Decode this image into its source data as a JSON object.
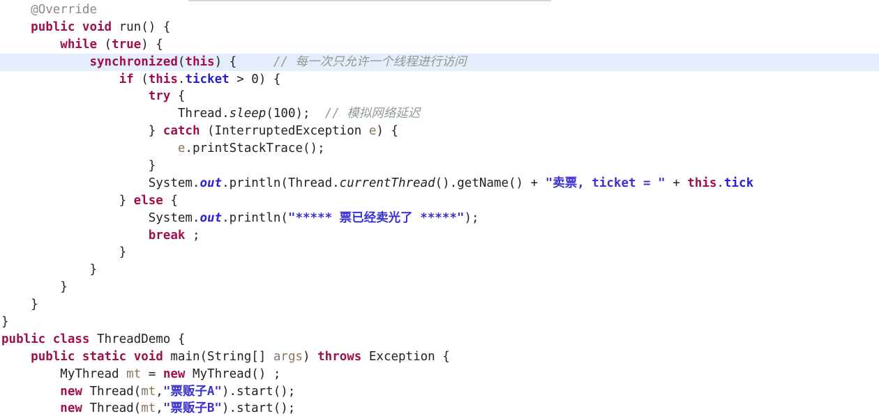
{
  "editor": {
    "kind": "java-source-code-view",
    "language": "Java",
    "background_color": "#ffffff",
    "current_line_highlight_color": "#e4edfb",
    "current_line_index": 3,
    "truncated_right_edge": true,
    "colors": {
      "keyword": "#a0104e",
      "plain_text": "#222222",
      "field": "#2a20d8",
      "static_member": "#2a20d8",
      "string_literal": "#3a32d0",
      "comment": "#8d9c92",
      "annotation": "#8a8a8a",
      "variable": "#8a7560"
    }
  },
  "lines": [
    {
      "n": 1,
      "indent": 4,
      "tokens": [
        {
          "t": "@Override",
          "c": "anno"
        }
      ]
    },
    {
      "n": 2,
      "indent": 4,
      "tokens": [
        {
          "t": "public",
          "c": "kw"
        },
        {
          "t": " ",
          "c": "plain"
        },
        {
          "t": "void",
          "c": "kw"
        },
        {
          "t": " run() {",
          "c": "plain"
        }
      ]
    },
    {
      "n": 3,
      "indent": 8,
      "tokens": [
        {
          "t": "while",
          "c": "kw"
        },
        {
          "t": " (",
          "c": "plain"
        },
        {
          "t": "true",
          "c": "kw"
        },
        {
          "t": ") {",
          "c": "plain"
        }
      ]
    },
    {
      "n": 4,
      "indent": 12,
      "current": true,
      "tokens": [
        {
          "t": "synchronized",
          "c": "kw"
        },
        {
          "t": "(",
          "c": "plain"
        },
        {
          "t": "this",
          "c": "kw"
        },
        {
          "t": ") {",
          "c": "plain"
        },
        {
          "t": "     ",
          "c": "plain"
        },
        {
          "t": "// 每一次只允许一个线程进行访问",
          "c": "cmt"
        }
      ]
    },
    {
      "n": 5,
      "indent": 16,
      "tokens": [
        {
          "t": "if",
          "c": "kw"
        },
        {
          "t": " (",
          "c": "plain"
        },
        {
          "t": "this",
          "c": "kw"
        },
        {
          "t": ".",
          "c": "plain"
        },
        {
          "t": "ticket",
          "c": "field"
        },
        {
          "t": " > ",
          "c": "plain"
        },
        {
          "t": "0",
          "c": "num"
        },
        {
          "t": ") {",
          "c": "plain"
        }
      ]
    },
    {
      "n": 6,
      "indent": 20,
      "tokens": [
        {
          "t": "try",
          "c": "kw"
        },
        {
          "t": " {",
          "c": "plain"
        }
      ]
    },
    {
      "n": 7,
      "indent": 24,
      "tokens": [
        {
          "t": "Thread.",
          "c": "plain"
        },
        {
          "t": "sleep",
          "c": "staticm"
        },
        {
          "t": "(",
          "c": "plain"
        },
        {
          "t": "100",
          "c": "num"
        },
        {
          "t": ");",
          "c": "plain"
        },
        {
          "t": "  ",
          "c": "plain"
        },
        {
          "t": "// 模拟网络延迟",
          "c": "cmt"
        }
      ]
    },
    {
      "n": 8,
      "indent": 20,
      "tokens": [
        {
          "t": "} ",
          "c": "plain"
        },
        {
          "t": "catch",
          "c": "kw"
        },
        {
          "t": " (InterruptedException ",
          "c": "plain"
        },
        {
          "t": "e",
          "c": "var"
        },
        {
          "t": ") {",
          "c": "plain"
        }
      ]
    },
    {
      "n": 9,
      "indent": 24,
      "tokens": [
        {
          "t": "e",
          "c": "var"
        },
        {
          "t": ".printStackTrace();",
          "c": "plain"
        }
      ]
    },
    {
      "n": 10,
      "indent": 20,
      "tokens": [
        {
          "t": "}",
          "c": "plain"
        }
      ]
    },
    {
      "n": 11,
      "indent": 20,
      "tokens": [
        {
          "t": "System.",
          "c": "plain"
        },
        {
          "t": "out",
          "c": "staticf"
        },
        {
          "t": ".println(Thread.",
          "c": "plain"
        },
        {
          "t": "currentThread",
          "c": "staticm"
        },
        {
          "t": "().getName() + ",
          "c": "plain"
        },
        {
          "t": "\"卖票, ticket = \"",
          "c": "str"
        },
        {
          "t": " + ",
          "c": "plain"
        },
        {
          "t": "this",
          "c": "kw"
        },
        {
          "t": ".",
          "c": "plain"
        },
        {
          "t": "tick",
          "c": "clip"
        }
      ]
    },
    {
      "n": 12,
      "indent": 16,
      "tokens": [
        {
          "t": "} ",
          "c": "plain"
        },
        {
          "t": "else",
          "c": "kw"
        },
        {
          "t": " {",
          "c": "plain"
        }
      ]
    },
    {
      "n": 13,
      "indent": 20,
      "tokens": [
        {
          "t": "System.",
          "c": "plain"
        },
        {
          "t": "out",
          "c": "staticf"
        },
        {
          "t": ".println(",
          "c": "plain"
        },
        {
          "t": "\"***** 票已经卖光了 *****\"",
          "c": "str"
        },
        {
          "t": ");",
          "c": "plain"
        }
      ]
    },
    {
      "n": 14,
      "indent": 20,
      "tokens": [
        {
          "t": "break",
          "c": "kw"
        },
        {
          "t": " ;",
          "c": "plain"
        }
      ]
    },
    {
      "n": 15,
      "indent": 16,
      "tokens": [
        {
          "t": "}",
          "c": "plain"
        }
      ]
    },
    {
      "n": 16,
      "indent": 12,
      "tokens": [
        {
          "t": "}",
          "c": "plain"
        }
      ]
    },
    {
      "n": 17,
      "indent": 8,
      "tokens": [
        {
          "t": "}",
          "c": "plain"
        }
      ]
    },
    {
      "n": 18,
      "indent": 4,
      "tokens": [
        {
          "t": "}",
          "c": "plain"
        }
      ]
    },
    {
      "n": 19,
      "indent": 0,
      "tokens": [
        {
          "t": "}",
          "c": "plain"
        }
      ]
    },
    {
      "n": 20,
      "indent": 0,
      "tokens": [
        {
          "t": "public",
          "c": "kw"
        },
        {
          "t": " ",
          "c": "plain"
        },
        {
          "t": "class",
          "c": "kw"
        },
        {
          "t": " ThreadDemo {",
          "c": "plain"
        }
      ]
    },
    {
      "n": 21,
      "indent": 4,
      "tokens": [
        {
          "t": "public",
          "c": "kw"
        },
        {
          "t": " ",
          "c": "plain"
        },
        {
          "t": "static",
          "c": "kw"
        },
        {
          "t": " ",
          "c": "plain"
        },
        {
          "t": "void",
          "c": "kw"
        },
        {
          "t": " main(String[] ",
          "c": "plain"
        },
        {
          "t": "args",
          "c": "var"
        },
        {
          "t": ") ",
          "c": "plain"
        },
        {
          "t": "throws",
          "c": "kw"
        },
        {
          "t": " Exception {",
          "c": "plain"
        }
      ]
    },
    {
      "n": 22,
      "indent": 8,
      "tokens": [
        {
          "t": "MyThread ",
          "c": "plain"
        },
        {
          "t": "mt",
          "c": "var"
        },
        {
          "t": " = ",
          "c": "plain"
        },
        {
          "t": "new",
          "c": "kw"
        },
        {
          "t": " MyThread() ;",
          "c": "plain"
        }
      ]
    },
    {
      "n": 23,
      "indent": 8,
      "tokens": [
        {
          "t": "new",
          "c": "kw"
        },
        {
          "t": " Thread(",
          "c": "plain"
        },
        {
          "t": "mt",
          "c": "var"
        },
        {
          "t": ",",
          "c": "plain"
        },
        {
          "t": "\"票贩子A\"",
          "c": "str"
        },
        {
          "t": ").start();",
          "c": "plain"
        }
      ]
    },
    {
      "n": 24,
      "indent": 8,
      "tokens": [
        {
          "t": "new",
          "c": "kw"
        },
        {
          "t": " Thread(",
          "c": "plain"
        },
        {
          "t": "mt",
          "c": "var"
        },
        {
          "t": ",",
          "c": "plain"
        },
        {
          "t": "\"票贩子B\"",
          "c": "str"
        },
        {
          "t": ").start();",
          "c": "plain"
        }
      ]
    }
  ]
}
